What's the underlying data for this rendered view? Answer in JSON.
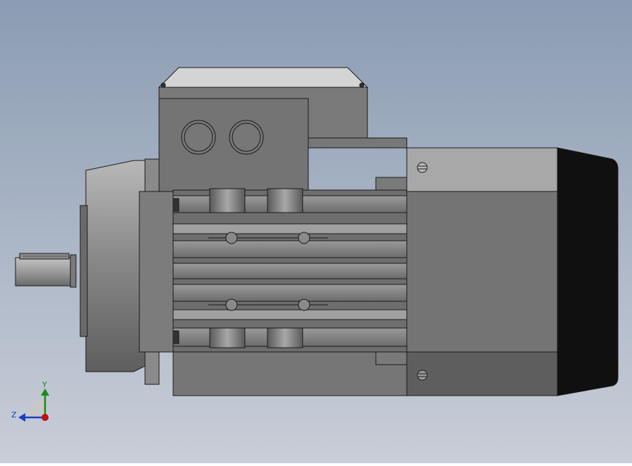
{
  "viewport": {
    "background_top": "#8b9cb3",
    "background_bottom": "#c9ced8"
  },
  "model": {
    "body_dark": "#707070",
    "body_mid": "#7e7e7e",
    "body_light": "#a9a9a9",
    "cover_black": "#101010",
    "outline": "#1a1a1a"
  },
  "triad": {
    "y_label": "Y",
    "z_label": "Z",
    "y_color": "#1a8a1a",
    "z_color": "#1a3fbf",
    "origin_color": "#c01010"
  }
}
